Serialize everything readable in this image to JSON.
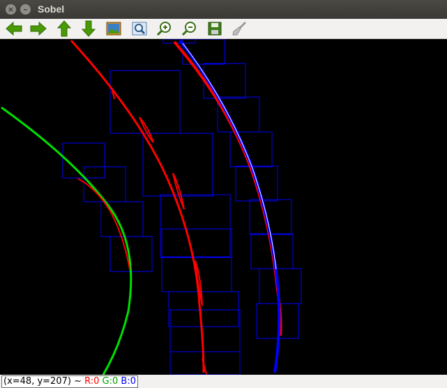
{
  "window": {
    "title": "Sobel",
    "close_glyph": "×",
    "minimize_glyph": "–"
  },
  "toolbar": {
    "buttons": [
      {
        "name": "pan-left-button",
        "icon": "arrow-left-icon"
      },
      {
        "name": "pan-right-button",
        "icon": "arrow-right-icon"
      },
      {
        "name": "pan-up-button",
        "icon": "arrow-up-icon"
      },
      {
        "name": "pan-down-button",
        "icon": "arrow-down-icon"
      },
      {
        "name": "zoom-reset-button",
        "icon": "image-icon"
      },
      {
        "name": "zoom-fit-button",
        "icon": "zoom-window-icon"
      },
      {
        "name": "zoom-in-button",
        "icon": "zoom-in-icon"
      },
      {
        "name": "zoom-out-button",
        "icon": "zoom-out-icon"
      },
      {
        "name": "save-button",
        "icon": "save-icon"
      },
      {
        "name": "properties-button",
        "icon": "brush-icon"
      }
    ]
  },
  "status": {
    "coords": "(x=48, y=207) ~",
    "r": "R:0",
    "g": "G:0",
    "b": "B:0"
  },
  "colors": {
    "left_lane": "#00e000",
    "center_lane": "#ff0000",
    "right_lane": "#0000ff",
    "window_box": "#0000ff",
    "background": "#000000"
  }
}
